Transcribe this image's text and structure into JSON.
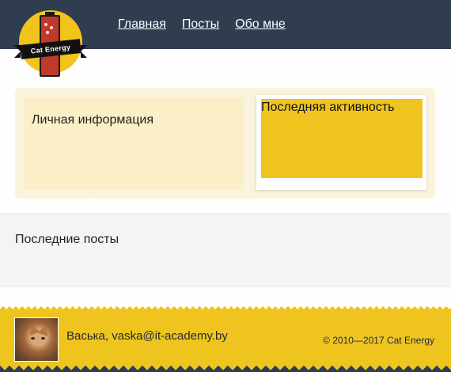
{
  "logo": {
    "text": "Cat Energy"
  },
  "nav": [
    {
      "label": "Главная"
    },
    {
      "label": "Посты"
    },
    {
      "label": "Обо мне"
    }
  ],
  "profile": {
    "info_title": "Личная информация",
    "activity_title": "Последняя активность"
  },
  "posts": {
    "title": "Последние посты"
  },
  "footer": {
    "contact": "Васька, vaska@it-academy.by",
    "copyright": "© 2010—2017 Cat Energy"
  },
  "colors": {
    "header_bg": "#2f3d4f",
    "accent_yellow": "#efc41f",
    "profile_bg": "#fbf4dd"
  }
}
